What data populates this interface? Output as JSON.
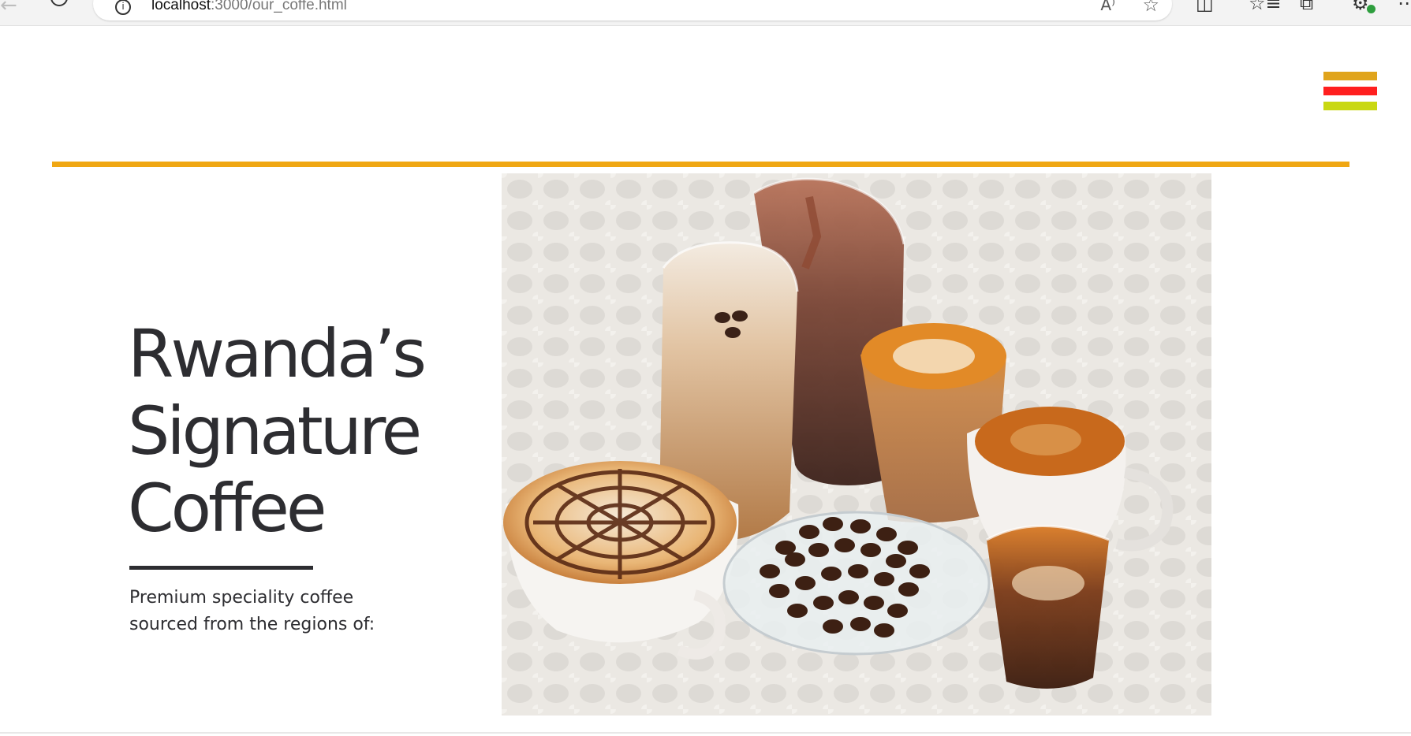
{
  "browser": {
    "url_host": "localhost",
    "url_rest": ":3000/our_coffe.html",
    "back_glyph": "←",
    "info_glyph": "i",
    "read_aloud_glyph": "A⁾",
    "favorite_glyph": "☆",
    "split_glyph": "◫",
    "favorites_list_glyph": "☆≡",
    "collections_glyph": "⧉",
    "extension_glyph": "⚙",
    "more_glyph": "⋯",
    "icons": [
      "back-icon",
      "reload-icon",
      "info-icon",
      "read-aloud-icon",
      "favorite-star-icon",
      "split-screen-icon",
      "favorites-list-icon",
      "collections-icon",
      "extension-icon",
      "more-icon"
    ]
  },
  "header": {
    "menu_icon": "hamburger-menu-icon",
    "menu_colors": [
      "#e0a41c",
      "#ff1f1f",
      "#c9d812"
    ],
    "rule_color": "#f0a713"
  },
  "hero": {
    "title_line1": "Rwanda’s",
    "title_line2": "Signature",
    "title_line3": "Coffee",
    "subtitle_line1": "Premium speciality coffee",
    "subtitle_line2": "sourced from the regions of:",
    "image_subject": "coffee-drinks-photo"
  }
}
